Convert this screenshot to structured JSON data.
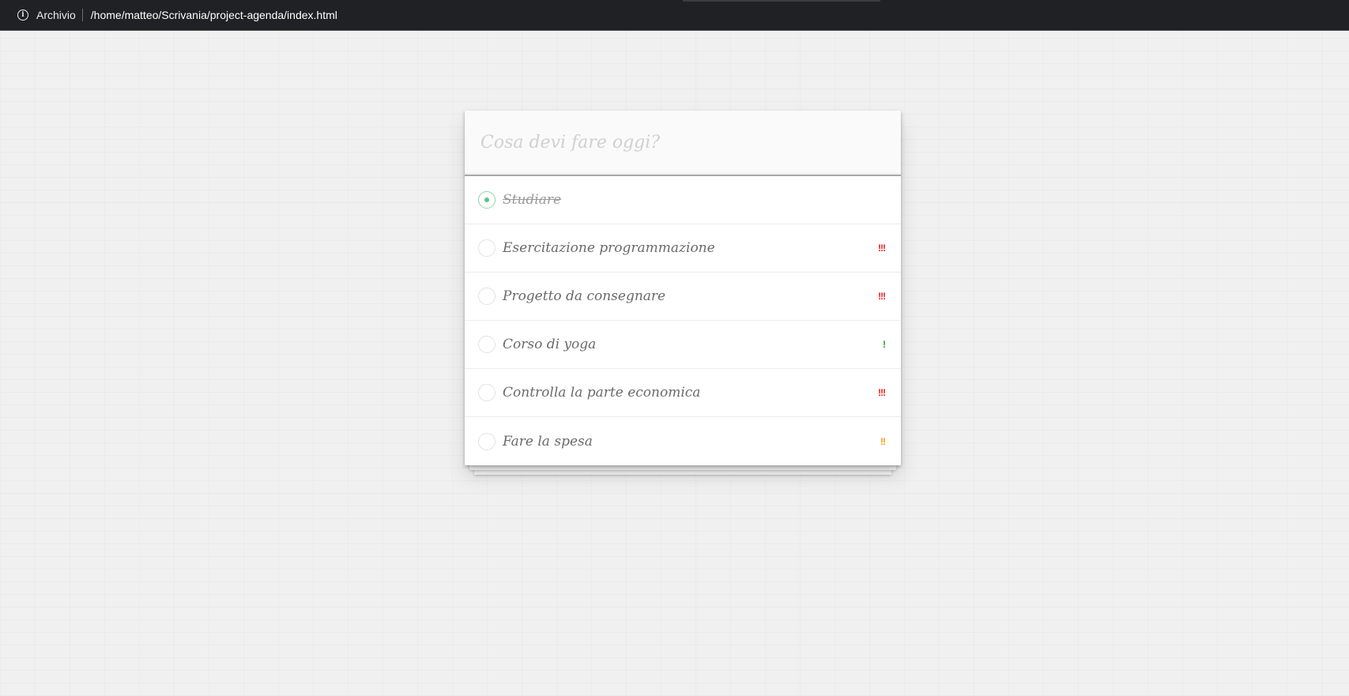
{
  "browser": {
    "site_label": "Archivio",
    "url": "/home/matteo/Scrivania/project-agenda/index.html"
  },
  "app": {
    "input_placeholder": "Cosa devi fare oggi?",
    "input_value": "",
    "todos": [
      {
        "label": "Studiare",
        "completed": true,
        "priority": "",
        "priority_color": ""
      },
      {
        "label": "Esercitazione programmazione",
        "completed": false,
        "priority": "!!!",
        "priority_color": "#e02020"
      },
      {
        "label": "Progetto da consegnare",
        "completed": false,
        "priority": "!!!",
        "priority_color": "#e02020"
      },
      {
        "label": "Corso di yoga",
        "completed": false,
        "priority": "!",
        "priority_color": "#2a9a2a"
      },
      {
        "label": "Controlla la parte economica",
        "completed": false,
        "priority": "!!!",
        "priority_color": "#e02020"
      },
      {
        "label": "Fare la spesa",
        "completed": false,
        "priority": "!!",
        "priority_color": "#f0a000"
      }
    ]
  },
  "colors": {
    "background": "#f0f0f0",
    "topbar": "#202124",
    "check_accent": "#5dc28a"
  },
  "icons": {
    "site_info": "info-icon",
    "toggle": "circle-checkbox-icon"
  }
}
